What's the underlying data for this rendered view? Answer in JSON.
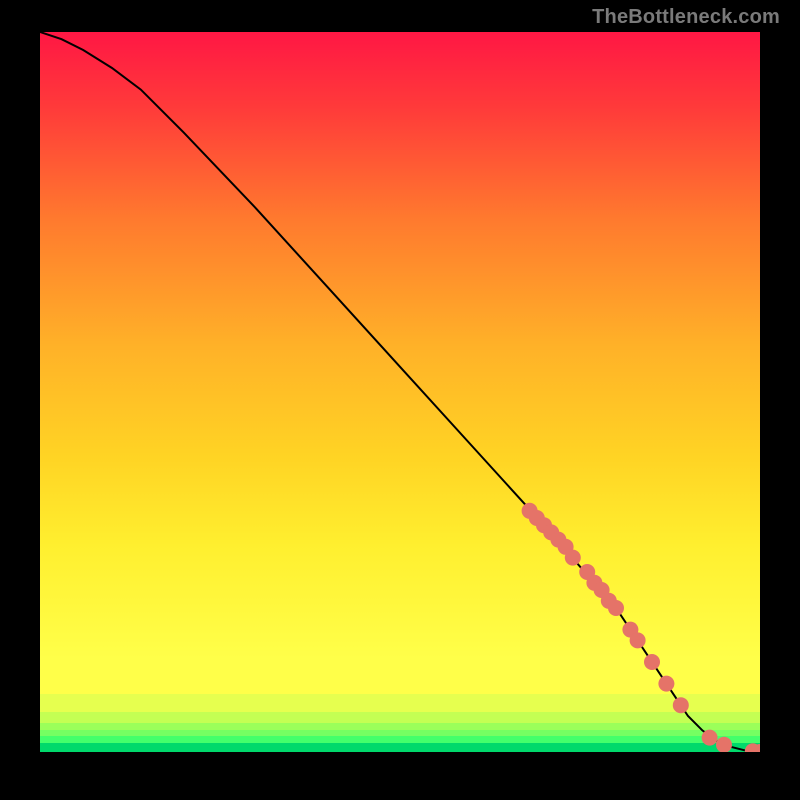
{
  "attribution": "TheBottleneck.com",
  "chart_data": {
    "type": "line",
    "xlabel": "",
    "ylabel": "",
    "xlim": [
      0,
      100
    ],
    "ylim": [
      0,
      100
    ],
    "series": [
      {
        "name": "curve",
        "x": [
          0,
          3,
          6,
          10,
          14,
          20,
          30,
          40,
          50,
          60,
          70,
          80,
          84,
          86,
          88,
          90,
          92,
          94,
          96,
          98,
          100
        ],
        "y": [
          100,
          99,
          97.5,
          95,
          92,
          86,
          75.5,
          64.5,
          53.5,
          42.5,
          31.5,
          20,
          14,
          11,
          8,
          5,
          3,
          1.5,
          0.7,
          0.2,
          0
        ]
      },
      {
        "name": "dots",
        "x": [
          68,
          69,
          70,
          71,
          72,
          73,
          74,
          76,
          77,
          78,
          79,
          80,
          82,
          83,
          85,
          87,
          89,
          93,
          95,
          99,
          100
        ],
        "y": [
          33.5,
          32.5,
          31.5,
          30.5,
          29.5,
          28.5,
          27,
          25,
          23.5,
          22.5,
          21,
          20,
          17,
          15.5,
          12.5,
          9.5,
          6.5,
          2,
          1,
          0.1,
          0
        ]
      }
    ],
    "background_bands": [
      {
        "y": 1.2,
        "color": "#00ff77"
      },
      {
        "y": 2.2,
        "color": "#43ff6b"
      },
      {
        "y": 3.0,
        "color": "#75ff62"
      },
      {
        "y": 4.0,
        "color": "#9bff5a"
      },
      {
        "y": 5.5,
        "color": "#c4ff53"
      },
      {
        "y": 8.0,
        "color": "#e6ff4f"
      },
      {
        "y": 13.0,
        "color": "#ffff49"
      },
      {
        "y": 100,
        "color": "gradient"
      }
    ]
  }
}
